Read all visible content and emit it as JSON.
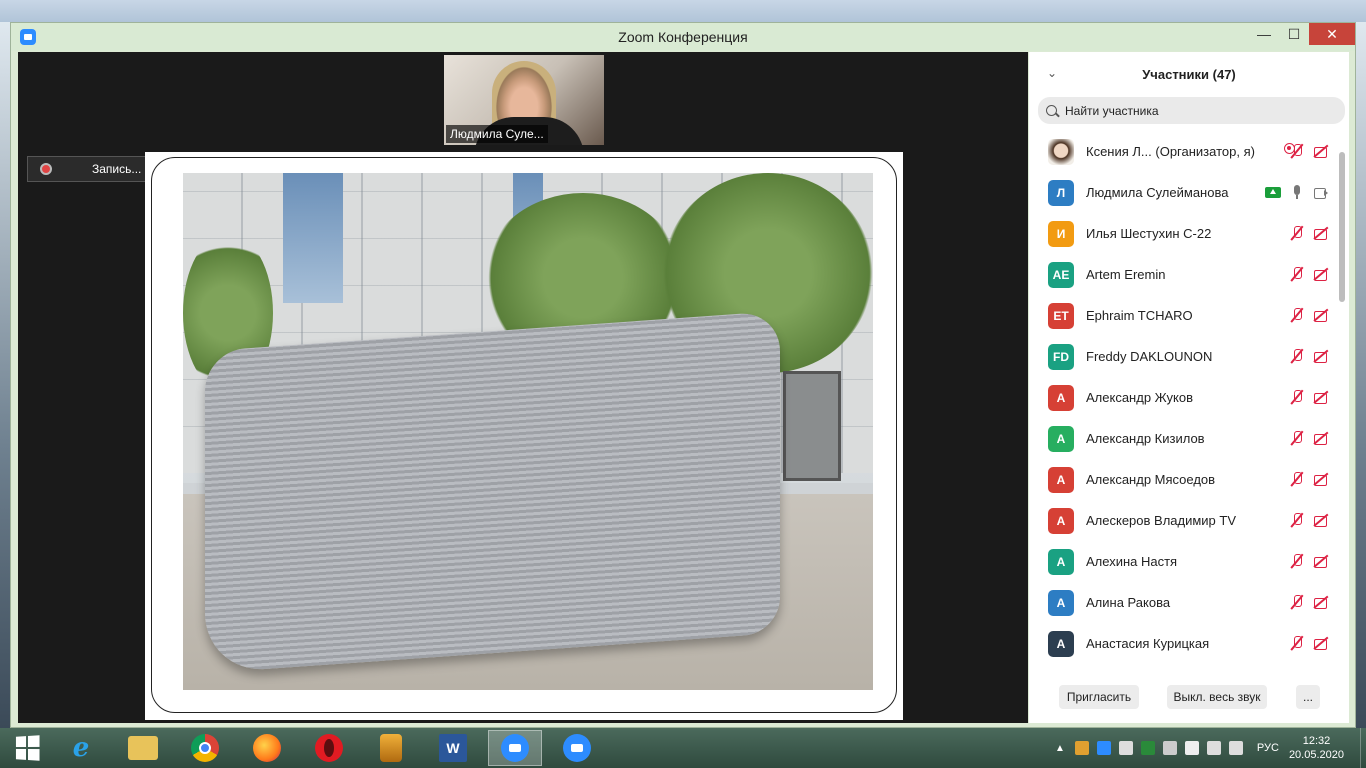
{
  "window": {
    "title": "Zoom Конференция",
    "minimize": "—",
    "maximize": "☐",
    "close": "✕"
  },
  "video": {
    "speaker_name": "Людмила Суле...",
    "recording_label": "Запись..."
  },
  "participants": {
    "header": "Участники (47)",
    "search_placeholder": "Найти участника",
    "list": [
      {
        "name": "Ксения Л...  (Организатор, я)",
        "initials": "",
        "color": "",
        "status": "host"
      },
      {
        "name": "Людмила Сулейманова",
        "initials": "Л",
        "color": "#2d7dc3",
        "status": "active"
      },
      {
        "name": "Илья Шестухин С-22",
        "initials": "И",
        "color": "#f29b12",
        "status": "muted"
      },
      {
        "name": "Artem Eremin",
        "initials": "AE",
        "color": "#1aa182",
        "status": "muted"
      },
      {
        "name": "Ephraim TCHARO",
        "initials": "ET",
        "color": "#d64035",
        "status": "muted"
      },
      {
        "name": "Freddy DAKLOUNON",
        "initials": "FD",
        "color": "#1aa182",
        "status": "muted"
      },
      {
        "name": "Александр Жуков",
        "initials": "А",
        "color": "#d64035",
        "status": "muted"
      },
      {
        "name": "Александр Кизилов",
        "initials": "А",
        "color": "#27ae60",
        "status": "muted"
      },
      {
        "name": "Александр Мясоедов",
        "initials": "А",
        "color": "#d64035",
        "status": "muted"
      },
      {
        "name": "Алескеров Владимир TV",
        "initials": "А",
        "color": "#d64035",
        "status": "muted"
      },
      {
        "name": "Алехина Настя",
        "initials": "А",
        "color": "#1aa182",
        "status": "muted"
      },
      {
        "name": "Алина Ракова",
        "initials": "А",
        "color": "#2d7dc3",
        "status": "muted"
      },
      {
        "name": "Анастасия Курицкая",
        "initials": "А",
        "color": "#2c3e50",
        "status": "muted"
      }
    ],
    "invite_button": "Пригласить",
    "mute_all_button": "Выкл. весь звук",
    "more_button": "..."
  },
  "taskbar": {
    "apps": [
      "start",
      "internet-explorer",
      "file-explorer",
      "chrome",
      "firefox",
      "opera",
      "archiver",
      "word",
      "zoom",
      "zoom"
    ],
    "language": "РУС",
    "time": "12:32",
    "date": "20.05.2020"
  }
}
